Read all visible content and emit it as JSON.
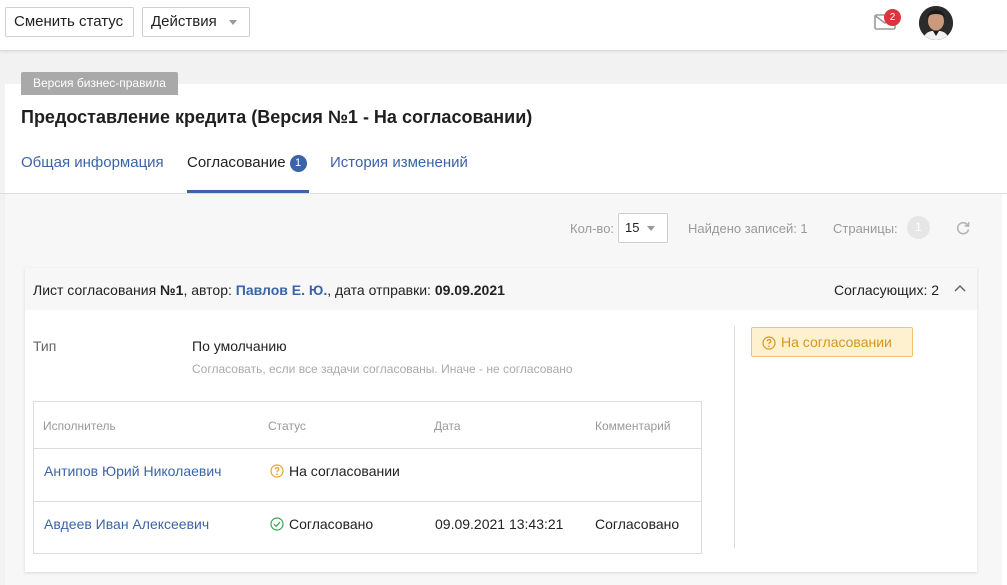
{
  "toolbar": {
    "change_status_label": "Сменить статус",
    "actions_label": "Действия",
    "notification_count": "2",
    "icons": [
      "mail-icon",
      "chevron-down-icon",
      "avatar"
    ]
  },
  "chip": {
    "label": "Версия бизнес-правила"
  },
  "page": {
    "title": "Предоставление кредита (Версия №1 - На согласовании)"
  },
  "tabs": [
    {
      "label": "Общая информация",
      "active": false
    },
    {
      "label": "Согласование",
      "count": "1",
      "active": true
    },
    {
      "label": "История изменений",
      "active": false
    }
  ],
  "pager": {
    "per_page_label": "Кол-во:",
    "per_page_value": "15",
    "found_label": "Найдено записей: 1",
    "pages_label": "Страницы:",
    "page_number": "1"
  },
  "sheet": {
    "title_prefix": "Лист согласования ",
    "number": "№1",
    "author_prefix": ", автор: ",
    "author": "Павлов Е. Ю.",
    "date_prefix": ", дата отправки: ",
    "date": "09.09.2021",
    "approvers_count": "Согласующих: 2",
    "type_label": "Тип",
    "type_value": "По умолчанию",
    "type_hint": "Согласовать, если все задачи согласованы. Иначе - не согласовано",
    "status": "На согласовании"
  },
  "table": {
    "headers": {
      "executor": "Исполнитель",
      "status": "Статус",
      "date": "Дата",
      "comment": "Комментарий"
    },
    "rows": [
      {
        "executor": "Антипов Юрий Николаевич",
        "status": "На согласовании",
        "status_icon": "question-circle-icon",
        "date": "",
        "comment": ""
      },
      {
        "executor": "Авдеев Иван Алексеевич",
        "status": "Согласовано",
        "status_icon": "check-circle-icon",
        "date": "09.09.2021 13:43:21",
        "comment": "Согласовано"
      }
    ]
  },
  "colors": {
    "accent": "#3b64a7",
    "badge_red": "#e0323c",
    "pending_border": "#f0c36d",
    "pending_bg": "#fdf1cf",
    "pending_text": "#d9961c",
    "approved_green": "#3aa655"
  }
}
